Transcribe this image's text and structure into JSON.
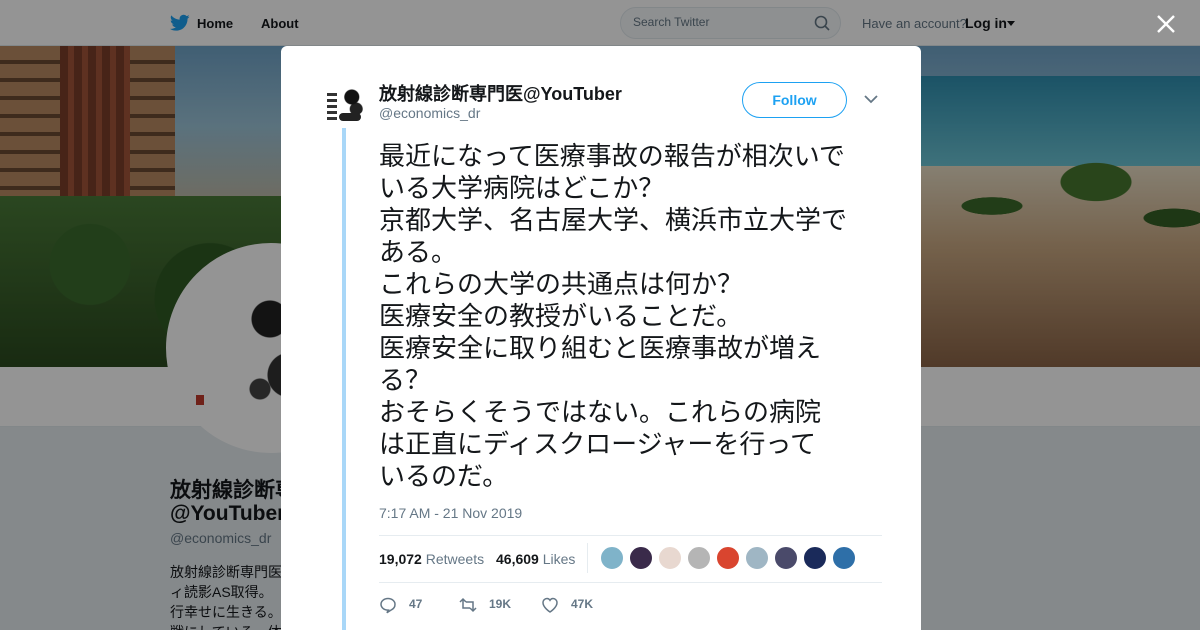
{
  "nav": {
    "logo": "twitter-bird",
    "home_label": "Home",
    "about_label": "About",
    "search_placeholder": "Search Twitter",
    "have_account": "Have an account?",
    "login_label": "Log in"
  },
  "profile": {
    "name_line1": "放射線診断専",
    "name_line2": "@YouTuber",
    "handle": "@economics_dr",
    "bio": "放射線診断専門医ィ読影AS取得。行幸せに生きる。戦にしている。体験"
  },
  "tweet": {
    "author_name": "放射線診断専門医@YouTuber",
    "author_handle": "@economics_dr",
    "follow_label": "Follow",
    "text_lines": [
      "最近になって医療事故の報告が相次いで",
      "いる大学病院はどこか？",
      "京都大学、名古屋大学、横浜市立大学で",
      "ある。",
      "これらの大学の共通点は何か？",
      "医療安全の教授がいることだ。",
      "医療安全に取り組むと医療事故が増え",
      "る？",
      "おそらくそうではない。これらの病院",
      "は正直にディスクロージャーを行って",
      "いるのだ。"
    ],
    "timestamp": "7:17 AM - 21 Nov 2019",
    "retweets_count": "19,072",
    "retweets_label": "Retweets",
    "likes_count": "46,609",
    "likes_label": "Likes",
    "reply_count": "47",
    "retweet_action_count": "19K",
    "like_action_count": "47K"
  },
  "likers": [
    {
      "color": "#7fb3c9"
    },
    {
      "color": "#3a2a4a"
    },
    {
      "color": "#e8d8d0"
    },
    {
      "color": "#b5b5b5"
    },
    {
      "color": "#d9452f"
    },
    {
      "color": "#9fb6c4"
    },
    {
      "color": "#4a4a6a"
    },
    {
      "color": "#1a2a5a"
    },
    {
      "color": "#2e6fa8"
    }
  ],
  "colors": {
    "accent": "#1da1f2",
    "thread_line": "#a9d7f8",
    "secondary_text": "#657786",
    "primary_text": "#14171a"
  }
}
